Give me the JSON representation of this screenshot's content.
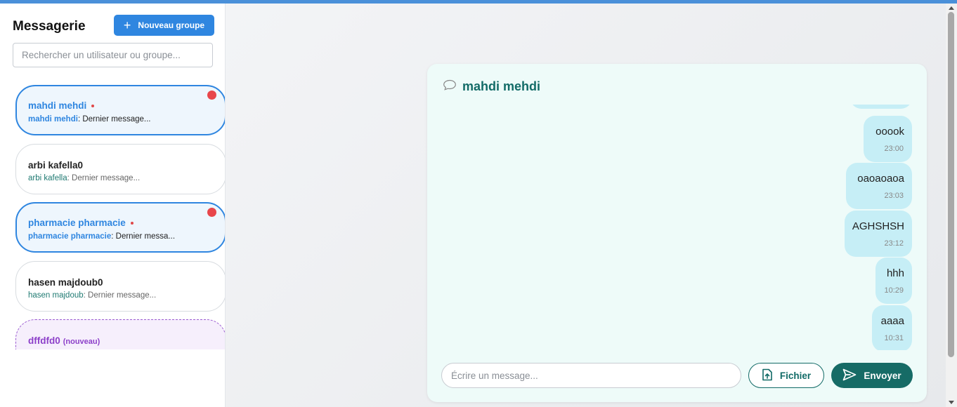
{
  "sidebar": {
    "title": "Messagerie",
    "new_group_label": "Nouveau groupe",
    "search_placeholder": "Rechercher un utilisateur ou groupe...",
    "conversations": [
      {
        "name": "mahdi mehdi",
        "who": "mahdi mehdi",
        "preview": ": Dernier message...",
        "active": true,
        "unread": true
      },
      {
        "name": "arbi kafella0",
        "who": "arbi kafella",
        "preview": ": Dernier message...",
        "active": false,
        "unread": false
      },
      {
        "name": "pharmacie pharmacie",
        "who": "pharmacie pharmacie",
        "preview": ": Dernier messa...",
        "active": true,
        "unread": true
      },
      {
        "name": "hasen majdoub0",
        "who": "hasen majdoub",
        "preview": ": Dernier message...",
        "active": false,
        "unread": false
      },
      {
        "name": "dffdfd0",
        "tag": "(nouveau)",
        "active": false,
        "unread": false
      }
    ]
  },
  "chat": {
    "title": "mahdi mehdi",
    "messages": [
      {
        "text": "ooook",
        "time": "23:00"
      },
      {
        "text": "oaoaoaoa",
        "time": "23:03"
      },
      {
        "text": "AGHSHSH",
        "time": "23:12"
      },
      {
        "text": "hhh",
        "time": "10:29"
      },
      {
        "text": "aaaa",
        "time": "10:31"
      }
    ],
    "input_placeholder": "Écrire un message...",
    "file_label": "Fichier",
    "send_label": "Envoyer"
  },
  "colors": {
    "accent": "#2f86e0",
    "teal": "#126b67",
    "bubble": "#c6eef6",
    "badge": "#e8464b",
    "new": "#8c3fc9"
  }
}
